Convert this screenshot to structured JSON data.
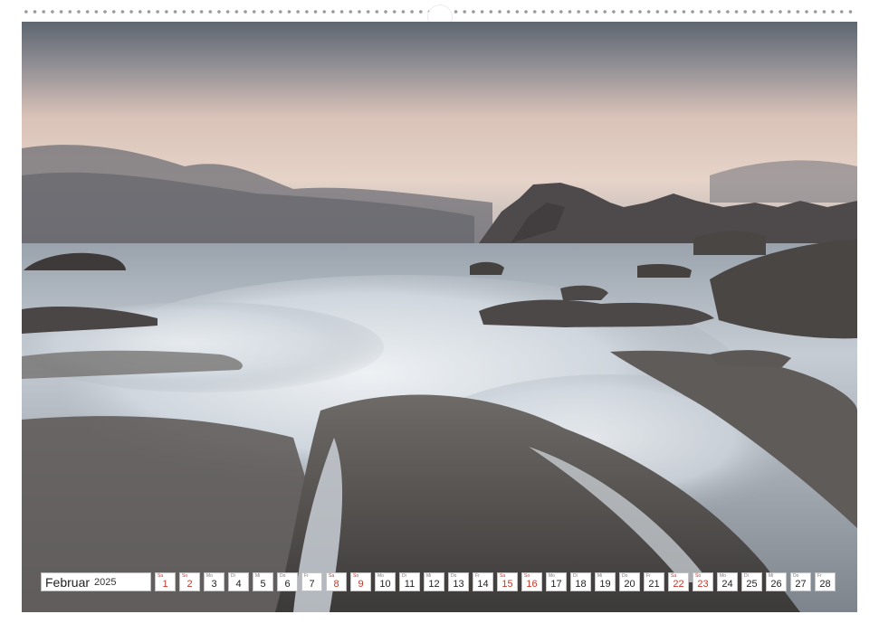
{
  "calendar": {
    "month": "Februar",
    "year": "2025",
    "days": [
      {
        "wd": "Sa",
        "n": "1",
        "we": true
      },
      {
        "wd": "So",
        "n": "2",
        "we": true
      },
      {
        "wd": "Mo",
        "n": "3",
        "we": false
      },
      {
        "wd": "Di",
        "n": "4",
        "we": false
      },
      {
        "wd": "Mi",
        "n": "5",
        "we": false
      },
      {
        "wd": "Do",
        "n": "6",
        "we": false
      },
      {
        "wd": "Fr",
        "n": "7",
        "we": false
      },
      {
        "wd": "Sa",
        "n": "8",
        "we": true
      },
      {
        "wd": "So",
        "n": "9",
        "we": true
      },
      {
        "wd": "Mo",
        "n": "10",
        "we": false
      },
      {
        "wd": "Di",
        "n": "11",
        "we": false
      },
      {
        "wd": "Mi",
        "n": "12",
        "we": false
      },
      {
        "wd": "Do",
        "n": "13",
        "we": false
      },
      {
        "wd": "Fr",
        "n": "14",
        "we": false
      },
      {
        "wd": "Sa",
        "n": "15",
        "we": true
      },
      {
        "wd": "So",
        "n": "16",
        "we": true
      },
      {
        "wd": "Mo",
        "n": "17",
        "we": false
      },
      {
        "wd": "Di",
        "n": "18",
        "we": false
      },
      {
        "wd": "Mi",
        "n": "19",
        "we": false
      },
      {
        "wd": "Do",
        "n": "20",
        "we": false
      },
      {
        "wd": "Fr",
        "n": "21",
        "we": false
      },
      {
        "wd": "Sa",
        "n": "22",
        "we": true
      },
      {
        "wd": "So",
        "n": "23",
        "we": true
      },
      {
        "wd": "Mo",
        "n": "24",
        "we": false
      },
      {
        "wd": "Di",
        "n": "25",
        "we": false
      },
      {
        "wd": "Mi",
        "n": "26",
        "we": false
      },
      {
        "wd": "Do",
        "n": "27",
        "we": false
      },
      {
        "wd": "Fr",
        "n": "28",
        "we": false
      }
    ]
  },
  "colors": {
    "weekend_text": "#c0392b",
    "weekday_text": "#222222"
  }
}
